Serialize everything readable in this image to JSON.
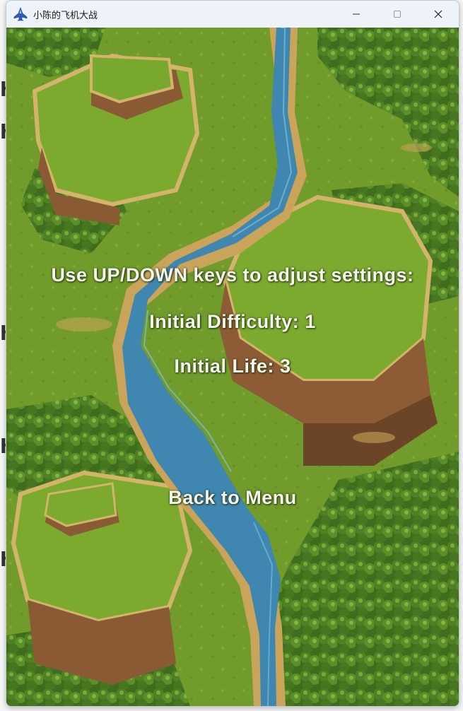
{
  "window": {
    "title": "小陈的飞机大战"
  },
  "icons": {
    "app": "plane-icon",
    "minimize": "minimize-icon",
    "maximize": "maximize-icon",
    "close": "close-icon"
  },
  "settings_menu": {
    "instructions": "Use UP/DOWN keys to adjust settings:",
    "initial_difficulty": "Initial Difficulty: 1",
    "initial_life": "Initial Life: 3",
    "back_label": "Back to Menu"
  },
  "colors": {
    "text": "#f4f4ee",
    "river": "#3f86b0",
    "grass": "#6f9a2a",
    "forest": "#3e6b1c",
    "cliff": "#8a5a34"
  }
}
